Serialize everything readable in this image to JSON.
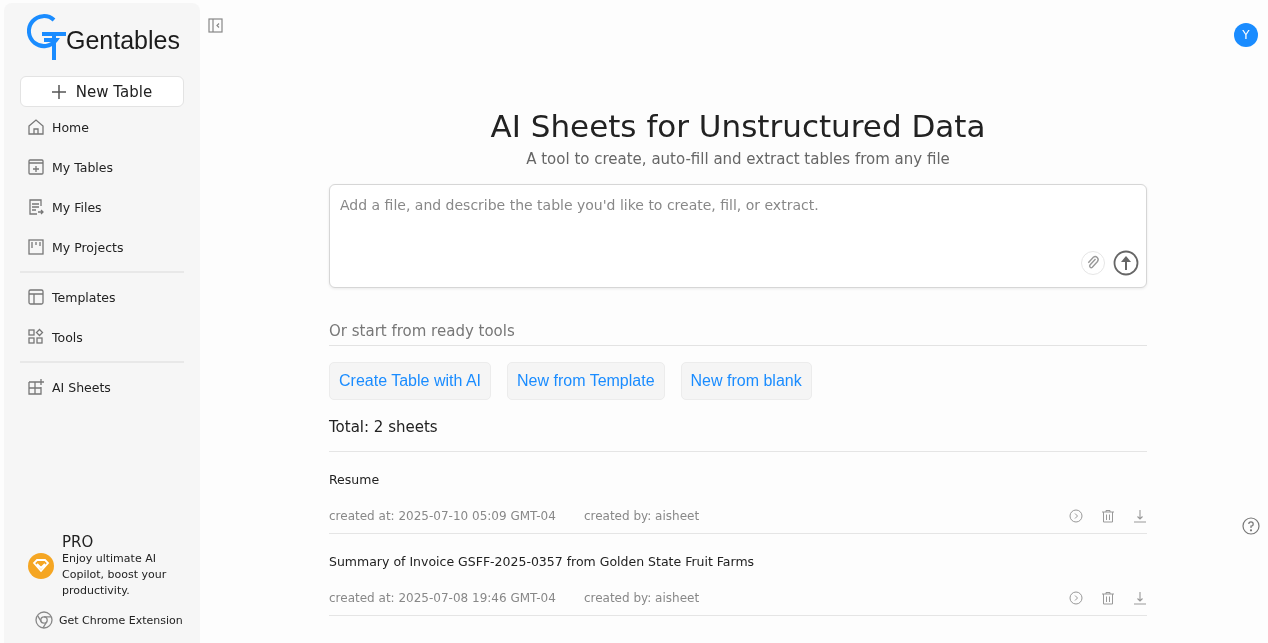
{
  "brand": {
    "name": "Gentables"
  },
  "sidebar": {
    "new_button": "New Table",
    "nav_groups": [
      [
        {
          "label": "Home"
        },
        {
          "label": "My Tables"
        },
        {
          "label": "My Files"
        },
        {
          "label": "My Projects"
        }
      ],
      [
        {
          "label": "Templates"
        },
        {
          "label": "Tools"
        }
      ],
      [
        {
          "label": "AI Sheets"
        }
      ]
    ],
    "pro": {
      "title": "PRO",
      "text": "Enjoy ultimate AI Copilot, boost your productivity."
    },
    "extension_link": "Get Chrome Extension"
  },
  "user": {
    "initial": "Y"
  },
  "hero": {
    "title": "AI Sheets for Unstructured Data",
    "subtitle": "A tool to create, auto-fill and extract tables from any file"
  },
  "prompt": {
    "placeholder": "Add a file, and describe the table you'd like to create, fill, or extract."
  },
  "tools": {
    "heading": "Or start from ready tools",
    "buttons": [
      "Create Table with AI",
      "New from Template",
      "New from blank"
    ]
  },
  "sheets": {
    "total": "Total: 2 sheets",
    "rows": [
      {
        "name": "Resume",
        "created_at": "created at: 2025-07-10 05:09 GMT-04",
        "created_by": "created by: aisheet"
      },
      {
        "name": "Summary of Invoice GSFF-2025-0357 from Golden State Fruit Farms",
        "created_at": "created at: 2025-07-08 19:46 GMT-04",
        "created_by": "created by: aisheet"
      }
    ]
  }
}
